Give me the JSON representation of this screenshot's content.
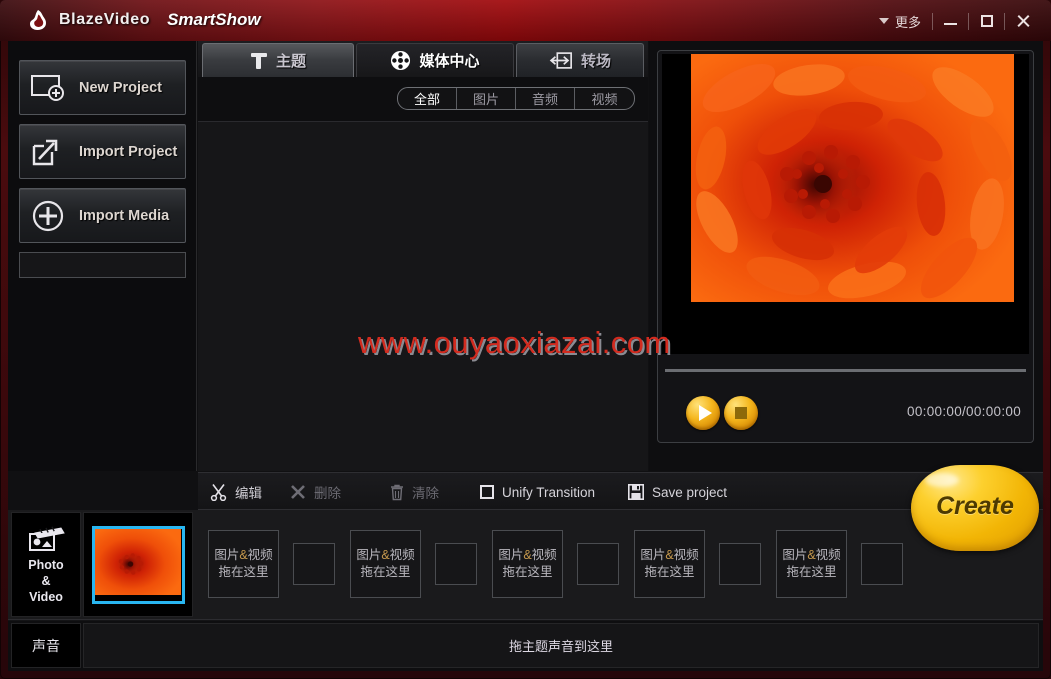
{
  "window": {
    "brand_primary": "BlazeVideo",
    "brand_secondary": "SmartShow",
    "more_label": "更多",
    "minimize_label": "Minimize",
    "maximize_label": "Maximize",
    "close_label": "Close",
    "accent_color": "#a1090c"
  },
  "sidebar": {
    "buttons": [
      {
        "label": "New Project",
        "icon": "new-project-icon"
      },
      {
        "label": "Import  Project",
        "icon": "import-project-icon"
      },
      {
        "label": "Import Media",
        "icon": "import-media-icon"
      }
    ]
  },
  "tabs": [
    {
      "label": "主题",
      "icon": "text-t-icon",
      "active": false
    },
    {
      "label": "媒体中心",
      "icon": "film-reel-icon",
      "active": true
    },
    {
      "label": "转场",
      "icon": "transition-arrow-icon",
      "active": false
    }
  ],
  "filters": [
    {
      "label": "全部",
      "active": true
    },
    {
      "label": "图片",
      "active": false
    },
    {
      "label": "音频",
      "active": false
    },
    {
      "label": "视频",
      "active": false
    }
  ],
  "preview": {
    "timecode": "00:00:00/00:00:00",
    "play_label": "Play",
    "stop_label": "Stop"
  },
  "create": {
    "label": "Create",
    "color": "#f2b505"
  },
  "toolbar": {
    "edit_label": "编辑",
    "delete_label": "删除",
    "clear_label": "清除",
    "unify_label": "Unify Transition",
    "unify_checked": false,
    "save_label": "Save project"
  },
  "timeline": {
    "photo_video_lines": [
      "Photo",
      "&",
      "Video"
    ],
    "audio_label": "声音",
    "audio_placeholder": "拖主题声音到这里",
    "drop_prefix": "图片",
    "drop_amp": "&",
    "drop_suffix": "视频",
    "drop_line2": "拖在这里",
    "selected_thumb_border": "#29b6f0",
    "drop_slots": 4,
    "transition_slots": 4
  },
  "watermark": {
    "text": "www.ouyaoxiazai.com",
    "color": "#d22b1f"
  }
}
